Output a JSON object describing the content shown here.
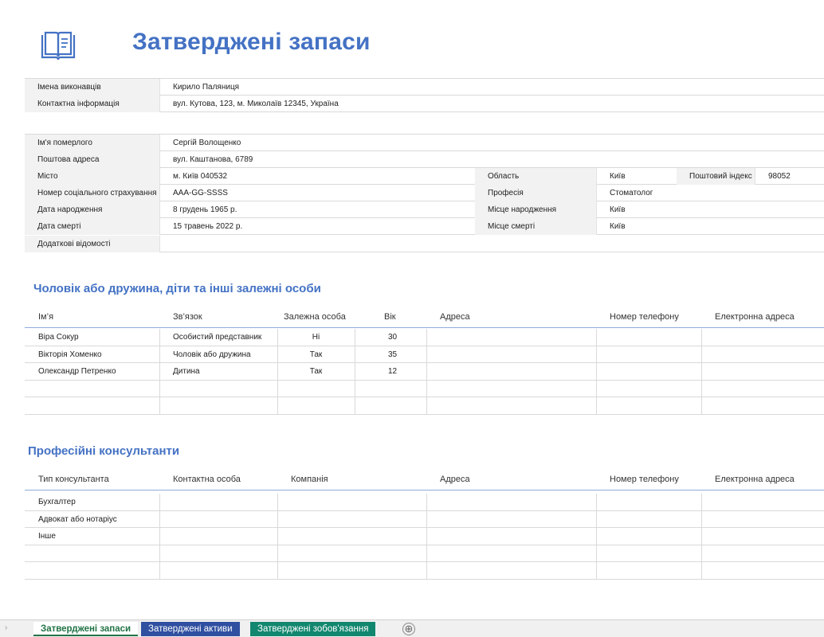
{
  "title": "Затверджені запаси",
  "executors": {
    "rows": [
      {
        "label": "Імена виконавців",
        "value": "Кирило Паляниця"
      },
      {
        "label": "Контактна інформація",
        "value": "вул. Кутова, 123, м. Миколаїв 12345, Україна"
      }
    ]
  },
  "deceased": {
    "name": {
      "label": "Ім'я померлого",
      "value": "Сергій Волощенко"
    },
    "address": {
      "label": "Поштова адреса",
      "value": "вул. Каштанова, 6789"
    },
    "city": {
      "label": "Місто",
      "value": "м. Київ 040532",
      "region_label": "Область",
      "region_value": "Київ",
      "zip_label": "Поштовий індекс",
      "zip_value": "98052"
    },
    "ssn": {
      "label": "Номер соціального страхування",
      "value": "AAA-GG-SSSS",
      "prof_label": "Професія",
      "prof_value": "Стоматолог"
    },
    "birth": {
      "label": "Дата народження",
      "value": "8 грудень 1965 р.",
      "place_label": "Місце народження",
      "place_value": "Київ"
    },
    "death": {
      "label": "Дата смерті",
      "value": "15 травень 2022 р.",
      "place_label": "Місце смерті",
      "place_value": "Київ"
    },
    "extra": {
      "label": "Додаткові відомості",
      "value": ""
    }
  },
  "dependents": {
    "title": "Чоловік або дружина, діти та інші залежні особи",
    "headers": [
      "Ім’я",
      "Зв’язок",
      "Залежна особа",
      "Вік",
      "Адреса",
      "Номер телефону",
      "Електронна адреса"
    ],
    "rows": [
      [
        "Віра Сокур",
        "Особистий представник",
        "Ні",
        "30",
        "",
        "",
        ""
      ],
      [
        "Вікторія Хоменко",
        "Чоловік або дружина",
        "Так",
        "35",
        "",
        "",
        ""
      ],
      [
        "Олександр Петренко",
        "Дитина",
        "Так",
        "12",
        "",
        "",
        ""
      ],
      [
        "",
        "",
        "",
        "",
        "",
        "",
        ""
      ],
      [
        "",
        "",
        "",
        "",
        "",
        "",
        ""
      ]
    ]
  },
  "advisors": {
    "title": "Професійні консультанти",
    "headers": [
      "Тип консультанта",
      "Контактна особа",
      "Компанія",
      "Адреса",
      "Номер телефону",
      "Електронна адреса"
    ],
    "rows": [
      [
        "Бухгалтер",
        "",
        "",
        "",
        "",
        ""
      ],
      [
        "Адвокат або нотаріус",
        "",
        "",
        "",
        "",
        ""
      ],
      [
        "Інше",
        "",
        "",
        "",
        "",
        ""
      ],
      [
        "",
        "",
        "",
        "",
        "",
        ""
      ],
      [
        "",
        "",
        "",
        "",
        "",
        ""
      ]
    ]
  },
  "tabs": [
    "Затверджені запаси",
    "Затверджені активи",
    "Затверджені зобов'язання"
  ],
  "add_sheet_icon": "⊕",
  "colors": {
    "accent": "#4472C4",
    "tab_active": "#217346",
    "tab_blue": "#2F4FA0",
    "tab_teal": "#12876F"
  }
}
